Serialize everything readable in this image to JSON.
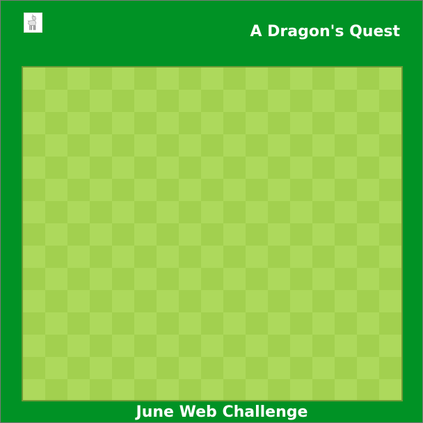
{
  "header": {
    "title": "A Dragon's Quest",
    "avatar_icon": "goat-icon"
  },
  "game": {
    "board": {
      "columns": 17,
      "rows": 15,
      "light_color": "#add95c",
      "dark_color": "#a2d04f"
    }
  },
  "footer": {
    "label": "June Web Challenge"
  },
  "colors": {
    "background": "#009225",
    "text": "#ffffff"
  }
}
